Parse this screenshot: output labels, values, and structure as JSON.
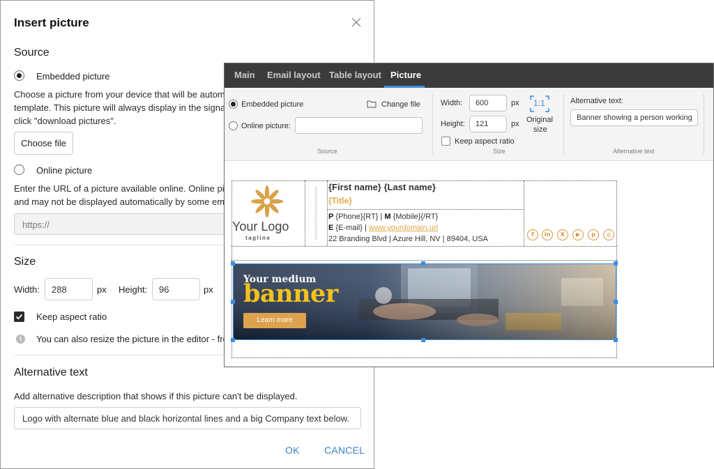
{
  "dialog": {
    "title": "Insert picture",
    "source_heading": "Source",
    "embedded_label": "Embedded picture",
    "embedded_desc_1": "Choose a picture from your device that will be autom",
    "embedded_desc_2": "template. This picture will always display in the signat",
    "embedded_desc_3": "click \"download pictures\".",
    "choose_file": "Choose file",
    "online_label": "Online picture",
    "online_desc_1": "Enter the URL of a picture available online. Online pic",
    "online_desc_2": "and may not be displayed automatically by some ema",
    "url_placeholder": "https://",
    "size_heading": "Size",
    "width_label": "Width:",
    "width_value": "288",
    "height_label": "Height:",
    "height_value": "96",
    "px": "px",
    "keep_aspect": "Keep aspect ratio",
    "resize_hint": "You can also resize the picture in the editor - fro",
    "alt_heading": "Alternative text",
    "alt_desc": "Add alternative description that shows if this picture can't be displayed.",
    "alt_value": "Logo with alternate blue and black horizontal lines and a big Company text below.",
    "ok": "OK",
    "cancel": "CANCEL"
  },
  "editor": {
    "tabs": [
      "Main",
      "Email layout",
      "Table layout",
      "Picture"
    ],
    "active_tab": "Picture",
    "ribbon": {
      "embedded_label": "Embedded picture",
      "change_file": "Change file",
      "online_label": "Online picture:",
      "source_caption": "Source",
      "width_label": "Width:",
      "width_value": "600",
      "height_label": "Height:",
      "height_value": "121",
      "px": "px",
      "ratio_icon_text": "1:1",
      "original_size_1": "Original",
      "original_size_2": "size",
      "keep_aspect": "Keep aspect ratio",
      "size_caption": "Size",
      "alt_label": "Alternative text:",
      "alt_value": "Banner showing a person working",
      "alt_caption": "Alternative text"
    },
    "signature": {
      "logo_text": "Your Logo",
      "logo_tagline": "tagline",
      "name": "{First name} {Last name}",
      "title": "{Title}",
      "phone_p": "P",
      "phone_text": "{Phone}{RT}",
      "mobile_m": "M",
      "mobile_text": "{Mobile}{/RT}",
      "email_e": "E",
      "email_text": "{E-mail}",
      "website": "www.yourdomain.url",
      "address": "22 Branding Blvd | Azure Hill, NV | 89404, USA",
      "social": [
        "f",
        "in",
        "X",
        "▶",
        "p",
        "◎"
      ]
    },
    "banner": {
      "small_text": "Your medium",
      "big_text": "banner",
      "button": "Learn more"
    }
  },
  "colors": {
    "accent_blue": "#3d8fe0",
    "brand_orange": "#e2a64a",
    "banner_yellow": "#f3c21c",
    "tabbar": "#3b3b3b"
  }
}
